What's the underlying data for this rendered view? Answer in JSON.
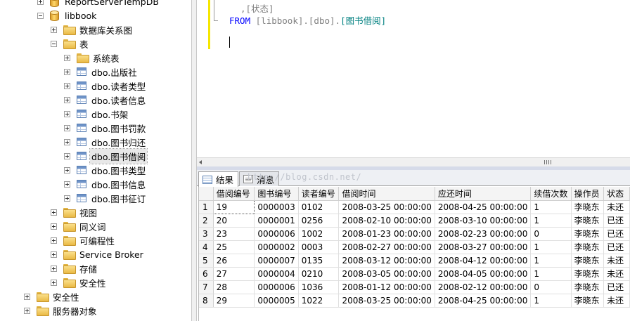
{
  "tree": {
    "nodes": [
      {
        "label": "ReportServerTempDB",
        "toggle": "plus",
        "icon": "database"
      },
      {
        "label": "libbook",
        "toggle": "minus",
        "icon": "database"
      },
      {
        "label": "数据库关系图",
        "toggle": "plus",
        "icon": "folder"
      },
      {
        "label": "表",
        "toggle": "minus",
        "icon": "folder"
      },
      {
        "label": "系统表",
        "toggle": "plus",
        "icon": "folder"
      },
      {
        "label": "dbo.出版社",
        "toggle": "plus",
        "icon": "table"
      },
      {
        "label": "dbo.读者类型",
        "toggle": "plus",
        "icon": "table"
      },
      {
        "label": "dbo.读者信息",
        "toggle": "plus",
        "icon": "table"
      },
      {
        "label": "dbo.书架",
        "toggle": "plus",
        "icon": "table"
      },
      {
        "label": "dbo.图书罚款",
        "toggle": "plus",
        "icon": "table"
      },
      {
        "label": "dbo.图书归还",
        "toggle": "plus",
        "icon": "table"
      },
      {
        "label": "dbo.图书借阅",
        "toggle": "plus",
        "icon": "table",
        "selected": true
      },
      {
        "label": "dbo.图书类型",
        "toggle": "plus",
        "icon": "table"
      },
      {
        "label": "dbo.图书信息",
        "toggle": "plus",
        "icon": "table"
      },
      {
        "label": "dbo.图书征订",
        "toggle": "plus",
        "icon": "table"
      },
      {
        "label": "视图",
        "toggle": "plus",
        "icon": "folder"
      },
      {
        "label": "同义词",
        "toggle": "plus",
        "icon": "folder"
      },
      {
        "label": "可编程性",
        "toggle": "plus",
        "icon": "folder"
      },
      {
        "label": "Service Broker",
        "toggle": "plus",
        "icon": "folder"
      },
      {
        "label": "存储",
        "toggle": "plus",
        "icon": "folder"
      },
      {
        "label": "安全性",
        "toggle": "plus",
        "icon": "folder"
      },
      {
        "label": "安全性",
        "toggle": "plus",
        "icon": "folder"
      },
      {
        "label": "服务器对象",
        "toggle": "plus",
        "icon": "folder"
      }
    ]
  },
  "editor": {
    "line1": {
      "prefix": ",",
      "column": "[状态]"
    },
    "line2": {
      "keyword": "FROM",
      "db": "[libbook]",
      "schema": "[dbo]",
      "table": "[图书借阅]"
    }
  },
  "results": {
    "tabs": [
      {
        "label": "结果",
        "icon": "grid-icon",
        "active": true
      },
      {
        "label": "消息",
        "icon": "message-icon",
        "active": false
      }
    ],
    "watermark": "http://blog.csdn.net/",
    "columns": [
      "借阅编号",
      "图书编号",
      "读者编号",
      "借阅时间",
      "应还时间",
      "续借次数",
      "操作员",
      "状态"
    ],
    "rows": [
      [
        "1",
        "19",
        "0000003",
        "0102",
        "2008-03-25 00:00:00",
        "2008-04-25 00:00:00",
        "1",
        "李晓东",
        "未还"
      ],
      [
        "2",
        "20",
        "0000001",
        "0256",
        "2008-02-10 00:00:00",
        "2008-03-10 00:00:00",
        "1",
        "李晓东",
        "已还"
      ],
      [
        "3",
        "23",
        "0000006",
        "1002",
        "2008-01-23 00:00:00",
        "2008-02-23 00:00:00",
        "0",
        "李晓东",
        "已还"
      ],
      [
        "4",
        "25",
        "0000002",
        "0003",
        "2008-02-27 00:00:00",
        "2008-03-27 00:00:00",
        "1",
        "李晓东",
        "已还"
      ],
      [
        "5",
        "26",
        "0000007",
        "0135",
        "2008-03-12 00:00:00",
        "2008-04-12 00:00:00",
        "1",
        "李晓东",
        "未还"
      ],
      [
        "6",
        "27",
        "0000004",
        "0210",
        "2008-03-05 00:00:00",
        "2008-04-05 00:00:00",
        "1",
        "李晓东",
        "未还"
      ],
      [
        "7",
        "28",
        "0000006",
        "1036",
        "2008-01-12 00:00:00",
        "2008-02-12 00:00:00",
        "0",
        "李晓东",
        "已还"
      ],
      [
        "8",
        "29",
        "0000005",
        "1022",
        "2008-03-25 00:00:00",
        "2008-04-25 00:00:00",
        "1",
        "李晓东",
        "未还"
      ]
    ]
  },
  "colors": {
    "keyword": "#0000ff",
    "identifier": "#808080",
    "table_name": "#008080",
    "changed_margin": "#f5e600"
  }
}
